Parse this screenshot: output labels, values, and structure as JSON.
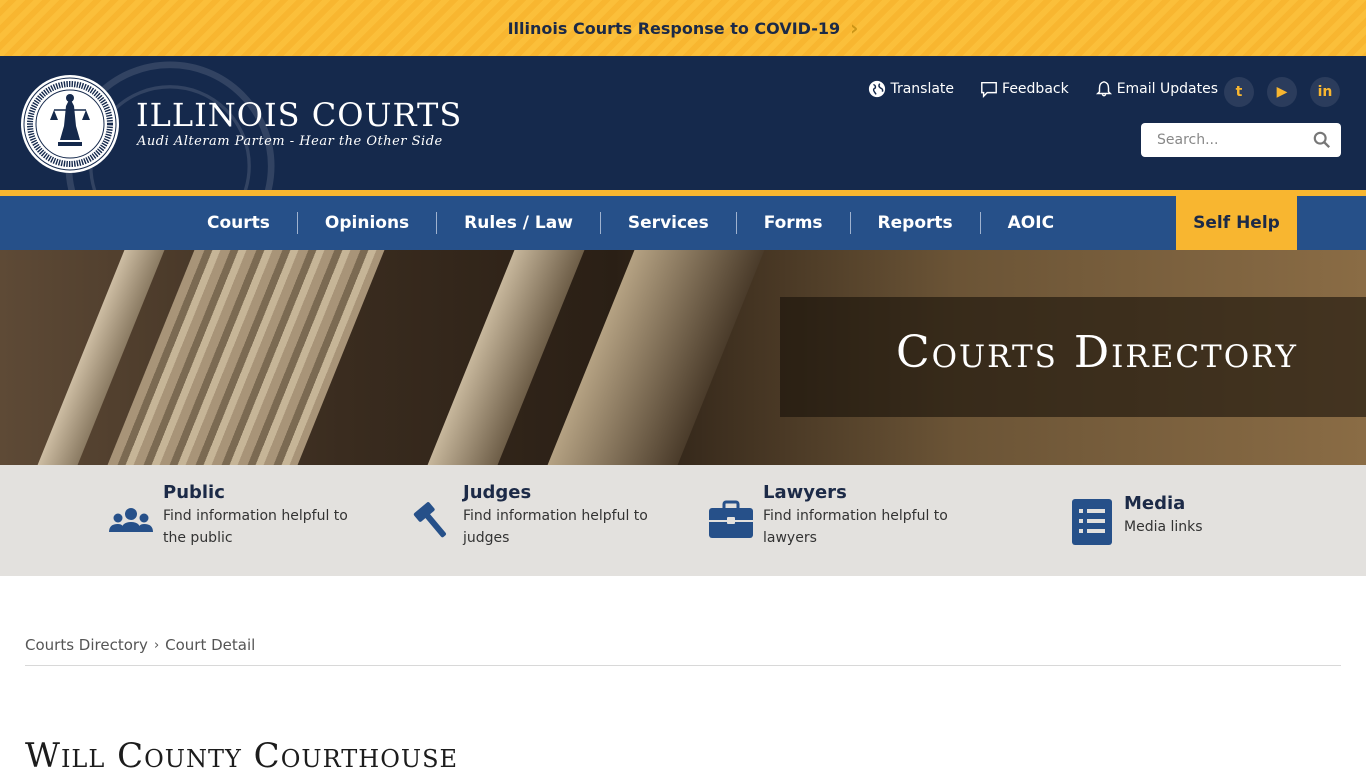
{
  "alert": {
    "text": "Illinois Courts Response to COVID-19",
    "chevron": "›"
  },
  "brand": {
    "title": "ILLINOIS COURTS",
    "subtitle": "Audi Alteram Partem - Hear the Other Side"
  },
  "utility": {
    "translate": "Translate",
    "feedback": "Feedback",
    "email_updates": "Email Updates"
  },
  "social": {
    "twitter": "t",
    "youtube": "▶",
    "linkedin": "in"
  },
  "search": {
    "placeholder": "Search..."
  },
  "nav": {
    "items": [
      "Courts",
      "Opinions",
      "Rules / Law",
      "Services",
      "Forms",
      "Reports",
      "AOIC"
    ],
    "self_help": "Self Help"
  },
  "hero": {
    "title": "Courts Directory"
  },
  "audience": [
    {
      "title": "Public",
      "desc": "Find information helpful to the public",
      "icon": "users-icon"
    },
    {
      "title": "Judges",
      "desc": "Find information helpful to judges",
      "icon": "gavel-icon"
    },
    {
      "title": "Lawyers",
      "desc": "Find information helpful to lawyers",
      "icon": "briefcase-icon"
    },
    {
      "title": "Media",
      "desc": "Media links",
      "icon": "list-icon"
    }
  ],
  "breadcrumb": {
    "items": [
      "Courts Directory",
      "Court Detail"
    ],
    "separator": "›"
  },
  "page": {
    "title": "Will County Courthouse"
  },
  "colors": {
    "navy": "#15294c",
    "nav_blue": "#265089",
    "gold": "#f8b630"
  }
}
